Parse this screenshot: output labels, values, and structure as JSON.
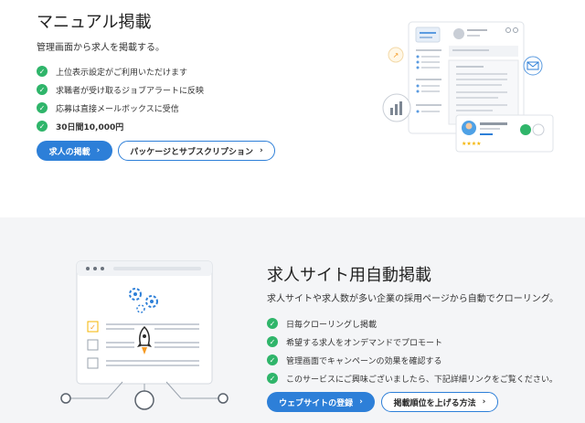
{
  "manual": {
    "title": "マニュアル掲載",
    "subtitle": "管理画面から求人を掲載する。",
    "features": [
      {
        "text": "上位表示設定がご利用いただけます",
        "bold": false
      },
      {
        "text": "求職者が受け取るジョブアラートに反映",
        "bold": false
      },
      {
        "text": "応募は直接メールボックスに受信",
        "bold": false
      },
      {
        "text": "30日間10,000円",
        "bold": true
      }
    ],
    "buttons": {
      "post_job": "求人の掲載",
      "packages": "パッケージとサブスクリプション"
    }
  },
  "crawl": {
    "title": "求人サイト用自動掲載",
    "subtitle": "求人サイトや求人数が多い企業の採用ページから自動でクローリング。",
    "features": [
      {
        "text": "日毎クローリングし掲載",
        "bold": false
      },
      {
        "text": "希望する求人をオンデマンドでプロモート",
        "bold": false
      },
      {
        "text": "管理画面でキャンペーンの効果を確認する",
        "bold": false
      },
      {
        "text": "このサービスにご興味ございましたら、下記詳細リンクをご覧ください。",
        "bold": false
      }
    ],
    "buttons": {
      "register_site": "ウェブサイトの登録",
      "ranking_method": "掲載順位を上げる方法"
    }
  },
  "icons": {
    "check": "check-circle-icon",
    "chevron": "chevron-right-icon"
  },
  "colors": {
    "accent": "#2d7fd8",
    "check": "#2fb56a",
    "rocket_flame": "#f59a23"
  }
}
